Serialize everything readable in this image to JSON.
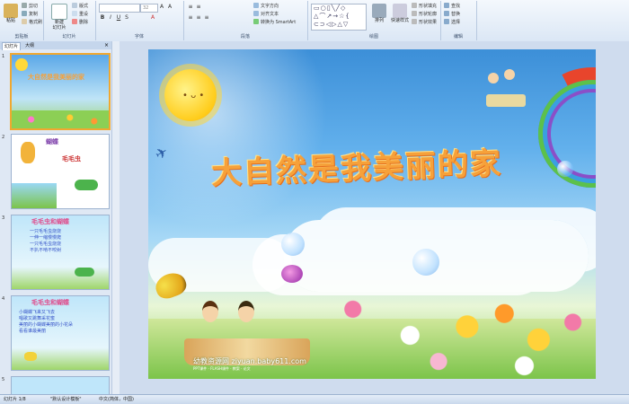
{
  "ribbon": {
    "clipboard": {
      "paste": "粘贴",
      "cut": "剪切",
      "copy": "复制",
      "format_painter": "格式刷",
      "group_label": "剪贴板"
    },
    "slides": {
      "new_slide": "新建\n幻灯片",
      "layout": "版式",
      "reset": "重设",
      "delete": "删除",
      "group_label": "幻灯片"
    },
    "font": {
      "font_name": "",
      "font_size": "32",
      "group_label": "字体"
    },
    "paragraph": {
      "text_direction": "文字方向",
      "align_text": "对齐文本",
      "smartart": "转换为 SmartArt",
      "group_label": "段落"
    },
    "drawing": {
      "arrange": "排列",
      "quick_styles": "快速样式",
      "shape_fill": "形状填充",
      "shape_outline": "形状轮廓",
      "shape_effects": "形状效果",
      "group_label": "绘图"
    },
    "editing": {
      "find": "查找",
      "replace": "替换",
      "select": "选择",
      "group_label": "编辑"
    }
  },
  "panel": {
    "tab_slides": "幻灯片",
    "tab_outline": "大纲",
    "thumbs": [
      {
        "num": "1",
        "title": "大自然是我美丽的家"
      },
      {
        "num": "2",
        "title": "蝴蝶",
        "sub": "毛毛虫"
      },
      {
        "num": "3",
        "title": "毛毛虫和蝴蝶",
        "lines": [
          "一只毛毛虫烧烧",
          "一伸一缩慢慢爬",
          "一只毛毛虫烧烧",
          "不扒不啃不咬树"
        ]
      },
      {
        "num": "4",
        "title": "毛毛虫和蝴蝶",
        "lines": [
          "小蝴蝶飞来又飞去",
          "唱歌又跳舞采花蜜",
          "美丽的小蝴蝶美丽的小花朵",
          "看看谁最美丽"
        ]
      },
      {
        "num": "5",
        "title": ""
      }
    ]
  },
  "slide": {
    "title": "大自然是我美丽的家",
    "watermark": "幼教资源网 ziyuan.baby611.com",
    "watermark_sub": "PPT课件 · FLASH课件 · 教案 · 论文"
  },
  "status": {
    "slide_count": "幻灯片 1/8",
    "theme": "\"默认设计模板\"",
    "language": "中文(简体，中国)"
  },
  "colors": {
    "title": "#f6a13a",
    "ribbon": "#dbe7f5",
    "selection": "#f0a830"
  }
}
